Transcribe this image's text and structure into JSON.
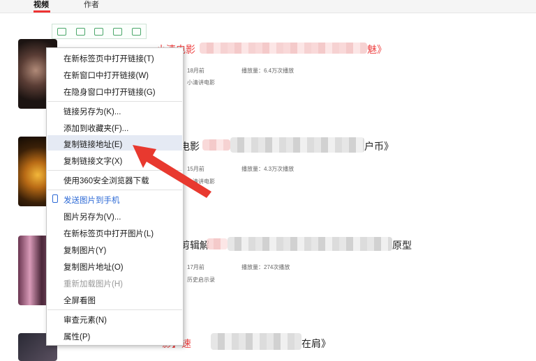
{
  "tabs": {
    "videos": "视频",
    "authors": "作者"
  },
  "image_toolbar": {
    "icons": [
      "save-icon",
      "fit-icon",
      "screenshot-icon",
      "export-icon",
      "settings-icon"
    ]
  },
  "results": [
    {
      "title_prefix": "小清电影",
      "title_suffix": "魅》",
      "date": "18月前",
      "plays": "播放量：6.4万次播放",
      "author": "小清讲电影"
    },
    {
      "title_prefix": "电影",
      "title_suffix": "户币》",
      "date": "15月前",
      "plays": "播放量：4.3万次播放",
      "author": "小清讲电影"
    },
    {
      "title_prefix": "剪辑解",
      "title_suffix": "原型",
      "date": "17月前",
      "plays": "播放量：274次播放",
      "author": "历史启示录"
    },
    {
      "title_prefix": "影】速",
      "title_suffix": "在肩》"
    }
  ],
  "context_menu": {
    "items": [
      "在新标签页中打开链接(T)",
      "在新窗口中打开链接(W)",
      "在隐身窗口中打开链接(G)",
      "链接另存为(K)...",
      "添加到收藏夹(F)...",
      "复制链接地址(E)",
      "复制链接文字(X)",
      "使用360安全浏览器下载",
      "发送图片到手机",
      "图片另存为(V)...",
      "在新标签页中打开图片(L)",
      "复制图片(Y)",
      "复制图片地址(O)",
      "重新加载图片(H)",
      "全屏看图",
      "审查元素(N)",
      "属性(P)"
    ],
    "highlighted_index": 5
  },
  "colors": {
    "accent": "#e33333",
    "arrow": "#e8392f",
    "menu_highlight": "#e5eaf4",
    "link_blue": "#2d6ad6"
  }
}
